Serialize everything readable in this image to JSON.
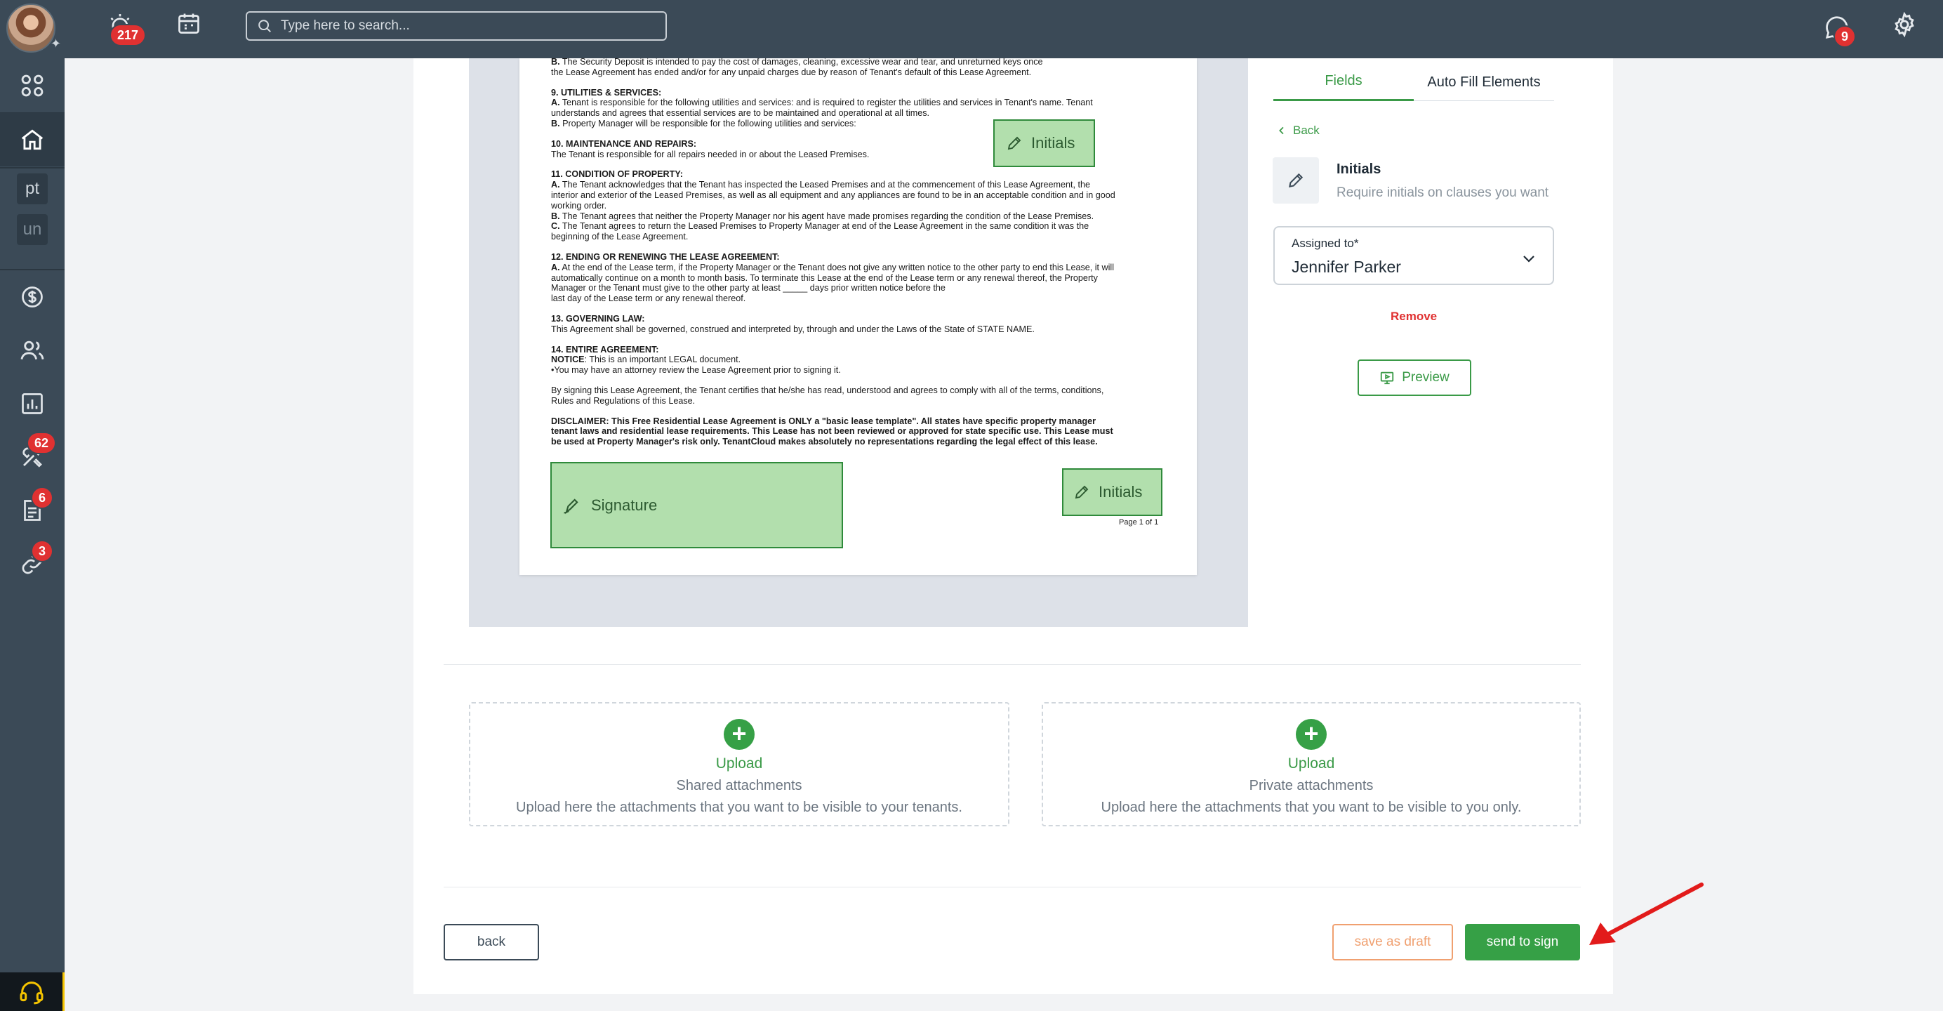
{
  "topbar": {
    "notifications_badge": "217",
    "search_placeholder": "Type here to search...",
    "messages_badge": "9"
  },
  "sidebar": {
    "items": [
      {
        "name": "apps",
        "icon": "grid-icon"
      },
      {
        "name": "home",
        "icon": "home-icon"
      },
      {
        "name": "pt",
        "label": "pt"
      },
      {
        "name": "un",
        "label": "un"
      },
      {
        "name": "finance",
        "icon": "dollar-icon"
      },
      {
        "name": "contacts",
        "icon": "people-icon"
      },
      {
        "name": "reports",
        "icon": "chart-icon"
      },
      {
        "name": "maintenance",
        "icon": "tools-icon",
        "badge": "62"
      },
      {
        "name": "documents",
        "icon": "document-icon",
        "badge": "6"
      },
      {
        "name": "links",
        "icon": "link-icon",
        "badge": "3"
      }
    ]
  },
  "document": {
    "lines": [
      {
        "b": "B.",
        "t": " The Security Deposit is intended to pay the cost of damages, cleaning, excessive wear and tear, and unreturned keys once"
      },
      {
        "t": "the Lease Agreement has ended and/or for any unpaid charges due by reason of Tenant's default of this Lease Agreement."
      },
      {
        "gap": true
      },
      {
        "b": "9. UTILITIES & SERVICES:"
      },
      {
        "b": "A.",
        "t": " Tenant is responsible for the following utilities and services:  and is required to register the utilities and services in Tenant's name. Tenant"
      },
      {
        "t": "understands and agrees that essential services are to be maintained and operational at all times."
      },
      {
        "b": "B.",
        "t": " Property Manager will be responsible for the following utilities and services:"
      },
      {
        "gap": true
      },
      {
        "b": "10. MAINTENANCE AND REPAIRS:"
      },
      {
        "t": "The Tenant is responsible for all repairs needed in or about the Leased Premises."
      },
      {
        "gap": true
      },
      {
        "b": "11. CONDITION OF PROPERTY:"
      },
      {
        "b": "A.",
        "t": " The Tenant acknowledges that the Tenant has inspected the Leased Premises and at the commencement of this Lease Agreement, the"
      },
      {
        "t": "interior and exterior of the Leased Premises, as well as all equipment and any appliances are found to be in an acceptable condition and in good"
      },
      {
        "t": "working order."
      },
      {
        "b": "B.",
        "t": " The Tenant agrees that neither the Property Manager nor his agent have made promises regarding the condition of the Lease Premises."
      },
      {
        "b": "C.",
        "t": " The Tenant agrees to return the Leased Premises to Property Manager at end of the Lease Agreement in the same condition it was the"
      },
      {
        "t": "beginning of the Lease Agreement."
      },
      {
        "gap": true
      },
      {
        "b": "12. ENDING OR RENEWING THE LEASE AGREEMENT:"
      },
      {
        "b": "A.",
        "t": " At the end of the Lease term, if the Property Manager or the Tenant does not give any written notice to the other party to end this Lease, it will"
      },
      {
        "t": "automatically continue on a month to month basis. To terminate this Lease at the end of the Lease term or any renewal thereof, the Property"
      },
      {
        "t": "Manager or the Tenant must give to the other party at least _____ days prior written notice before the"
      },
      {
        "t": "last day of the Lease term or any renewal thereof."
      },
      {
        "gap": true
      },
      {
        "b": "13. GOVERNING LAW:"
      },
      {
        "t": "This Agreement shall be governed, construed and interpreted by, through and under the Laws of the State of STATE NAME."
      },
      {
        "gap": true
      },
      {
        "b": "14. ENTIRE AGREEMENT:"
      },
      {
        "b": "NOTICE",
        "t": ": This is an important LEGAL document."
      },
      {
        "t": "•You may have an attorney review the Lease Agreement prior to signing it."
      },
      {
        "gap": true
      },
      {
        "t": "By signing this Lease Agreement, the Tenant certifies that he/she has read, understood and agrees to comply with all of the terms, conditions,"
      },
      {
        "t": "Rules and Regulations of this Lease."
      },
      {
        "gap": true
      },
      {
        "b": "DISCLAIMER: This Free Residential Lease Agreement is ONLY a \"basic lease template\". All states have specific property manager"
      },
      {
        "b": "tenant laws and residential lease requirements. This Lease has not been reviewed or approved for state specific use. This Lease must"
      },
      {
        "b": "be used at Property Manager's risk only. TenantCloud makes absolutely no representations regarding the legal effect of this lease."
      }
    ],
    "page_number": "Page 1 of 1",
    "fields": {
      "initials_top": "Initials",
      "initials_bottom": "Initials",
      "signature": "Signature"
    }
  },
  "panel": {
    "tabs": [
      "Fields",
      "Auto Fill Elements"
    ],
    "back_label": "Back",
    "field_title": "Initials",
    "field_desc": "Require initials on clauses you want",
    "assigned_label": "Assigned to*",
    "assigned_value": "Jennifer Parker",
    "remove_label": "Remove",
    "preview_label": "Preview"
  },
  "uploads": [
    {
      "action": "Upload",
      "title": "Shared attachments",
      "desc": "Upload here the attachments that you want to be visible to your tenants."
    },
    {
      "action": "Upload",
      "title": "Private attachments",
      "desc": "Upload here the attachments that you want to be visible to you only."
    }
  ],
  "footer": {
    "back_label": "back",
    "draft_label": "save as draft",
    "send_label": "send to sign"
  },
  "colors": {
    "accent": "#36a046",
    "danger": "#e03131",
    "topbar": "#3b4a57",
    "draft": "#f0a070",
    "field_fill": "#b2dfad"
  }
}
